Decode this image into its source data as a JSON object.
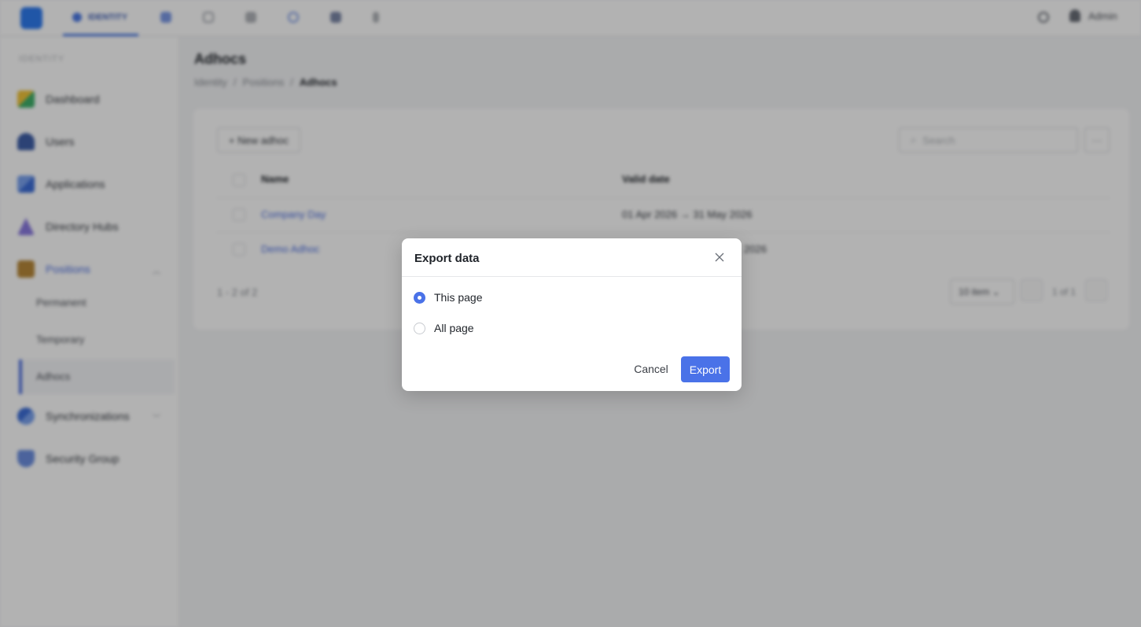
{
  "topbar": {
    "active_tab": "IDENTITY",
    "user": "Admin",
    "icon_names": [
      "app-logo-icon",
      "tab-icon-1",
      "tab-icon-2",
      "tab-icon-3",
      "tab-icon-4",
      "tab-icon-5",
      "tab-icon-6",
      "bell-icon",
      "user-icon"
    ]
  },
  "sidebar": {
    "header": "IDENTITY",
    "items": [
      {
        "label": "Dashboard",
        "icon": "dashboard-icon"
      },
      {
        "label": "Users",
        "icon": "users-icon"
      },
      {
        "label": "Applications",
        "icon": "applications-icon"
      },
      {
        "label": "Directory Hubs",
        "icon": "directory-hubs-icon"
      },
      {
        "label": "Positions",
        "icon": "positions-icon"
      },
      {
        "label": "Synchronizations",
        "icon": "synchronizations-icon"
      },
      {
        "label": "Security Group",
        "icon": "security-group-icon"
      }
    ],
    "sub_items": [
      "Permanent",
      "Temporary",
      "Adhocs"
    ]
  },
  "page": {
    "title": "Adhocs",
    "breadcrumb": [
      "Identity",
      "Positions",
      "Adhocs"
    ]
  },
  "table": {
    "new_button": "+ New adhoc",
    "search_placeholder": "Search",
    "more_button": "···",
    "headers": {
      "name": "Name",
      "valid_date": "Valid date"
    },
    "rows": [
      {
        "name": "Company Day",
        "valid_date": "01 Apr 2026 → 31 May 2026"
      },
      {
        "name": "Demo Adhoc",
        "valid_date": "2026"
      }
    ],
    "count_label": "1 - 2 of 2",
    "page_size": "10 item ⌄",
    "page_label": "1 of 1"
  },
  "modal": {
    "title": "Export data",
    "options": [
      {
        "label": "This page",
        "selected": true
      },
      {
        "label": "All page",
        "selected": false
      }
    ],
    "cancel_label": "Cancel",
    "export_label": "Export"
  },
  "colors": {
    "primary": "#4a72e8",
    "overlay": "rgba(0,0,0,0.30)"
  }
}
